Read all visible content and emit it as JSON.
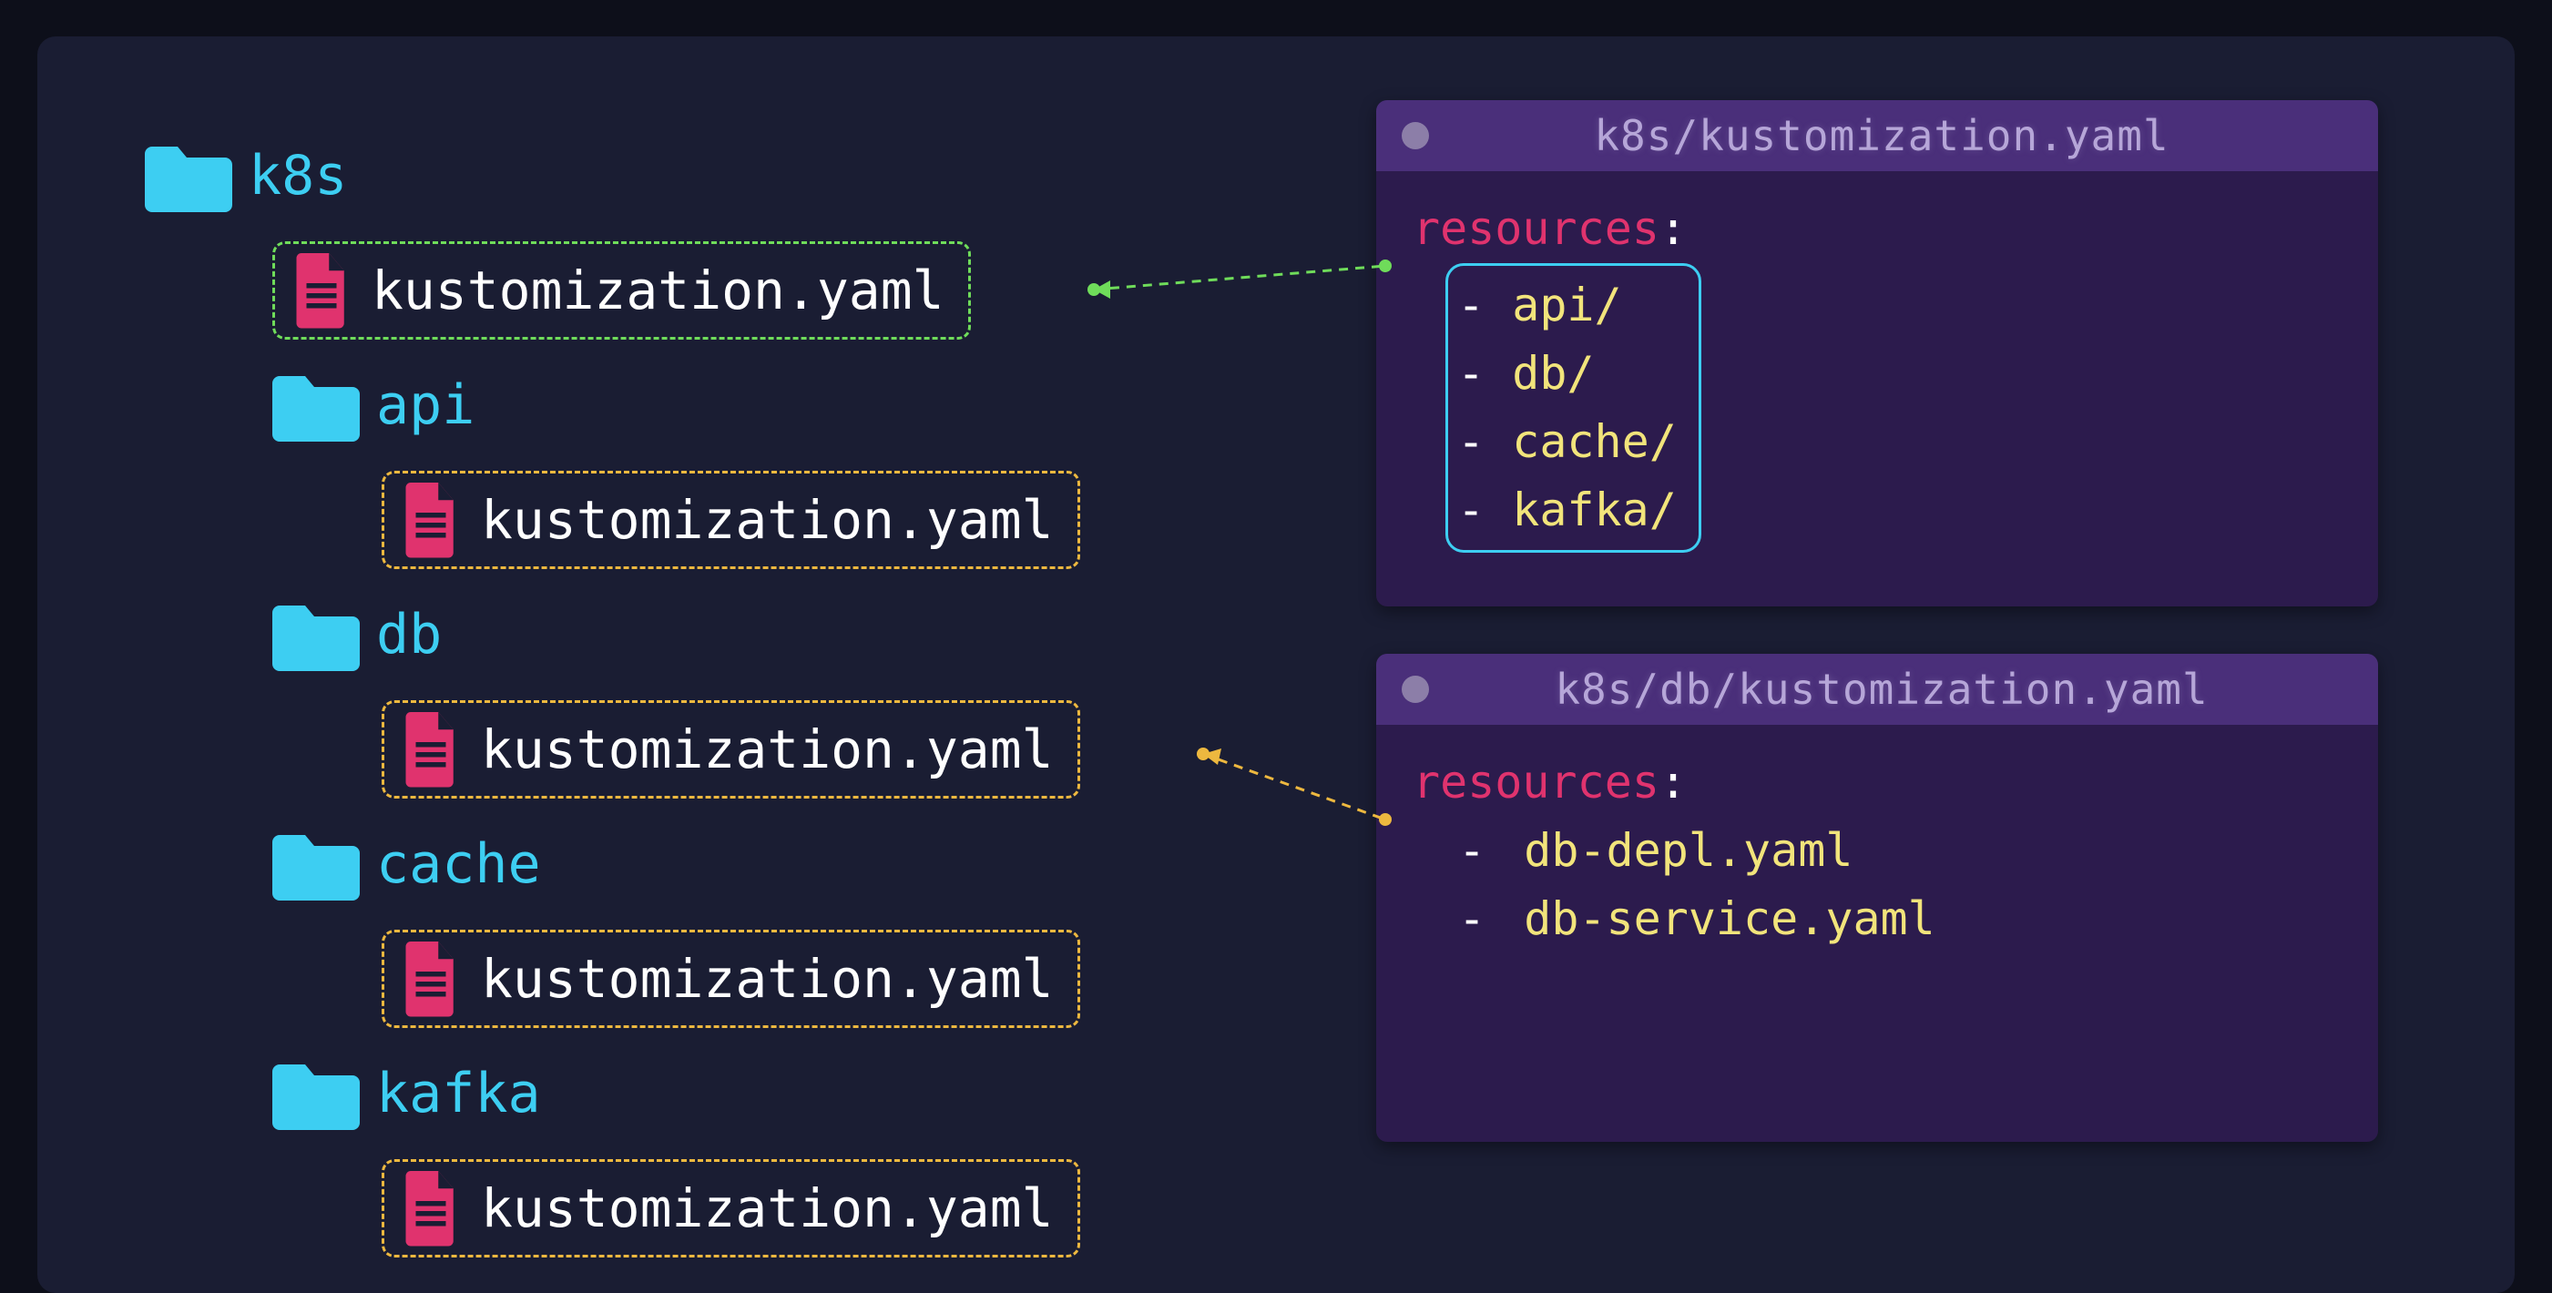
{
  "tree": {
    "root": "k8s",
    "root_file": "kustomization.yaml",
    "folders": [
      {
        "name": "api",
        "file": "kustomization.yaml"
      },
      {
        "name": "db",
        "file": "kustomization.yaml"
      },
      {
        "name": "cache",
        "file": "kustomization.yaml"
      },
      {
        "name": "kafka",
        "file": "kustomization.yaml"
      }
    ]
  },
  "panel1": {
    "title": "k8s/kustomization.yaml",
    "key": "resources",
    "colon": ":",
    "items": [
      "api/",
      "db/",
      "cache/",
      "kafka/"
    ]
  },
  "panel2": {
    "title": "k8s/db/kustomization.yaml",
    "key": "resources",
    "colon": ":",
    "items": [
      "db-depl.yaml",
      "db-service.yaml"
    ]
  },
  "icons": {
    "folder_color": "#3dcef2",
    "file_color": "#e0336e"
  }
}
